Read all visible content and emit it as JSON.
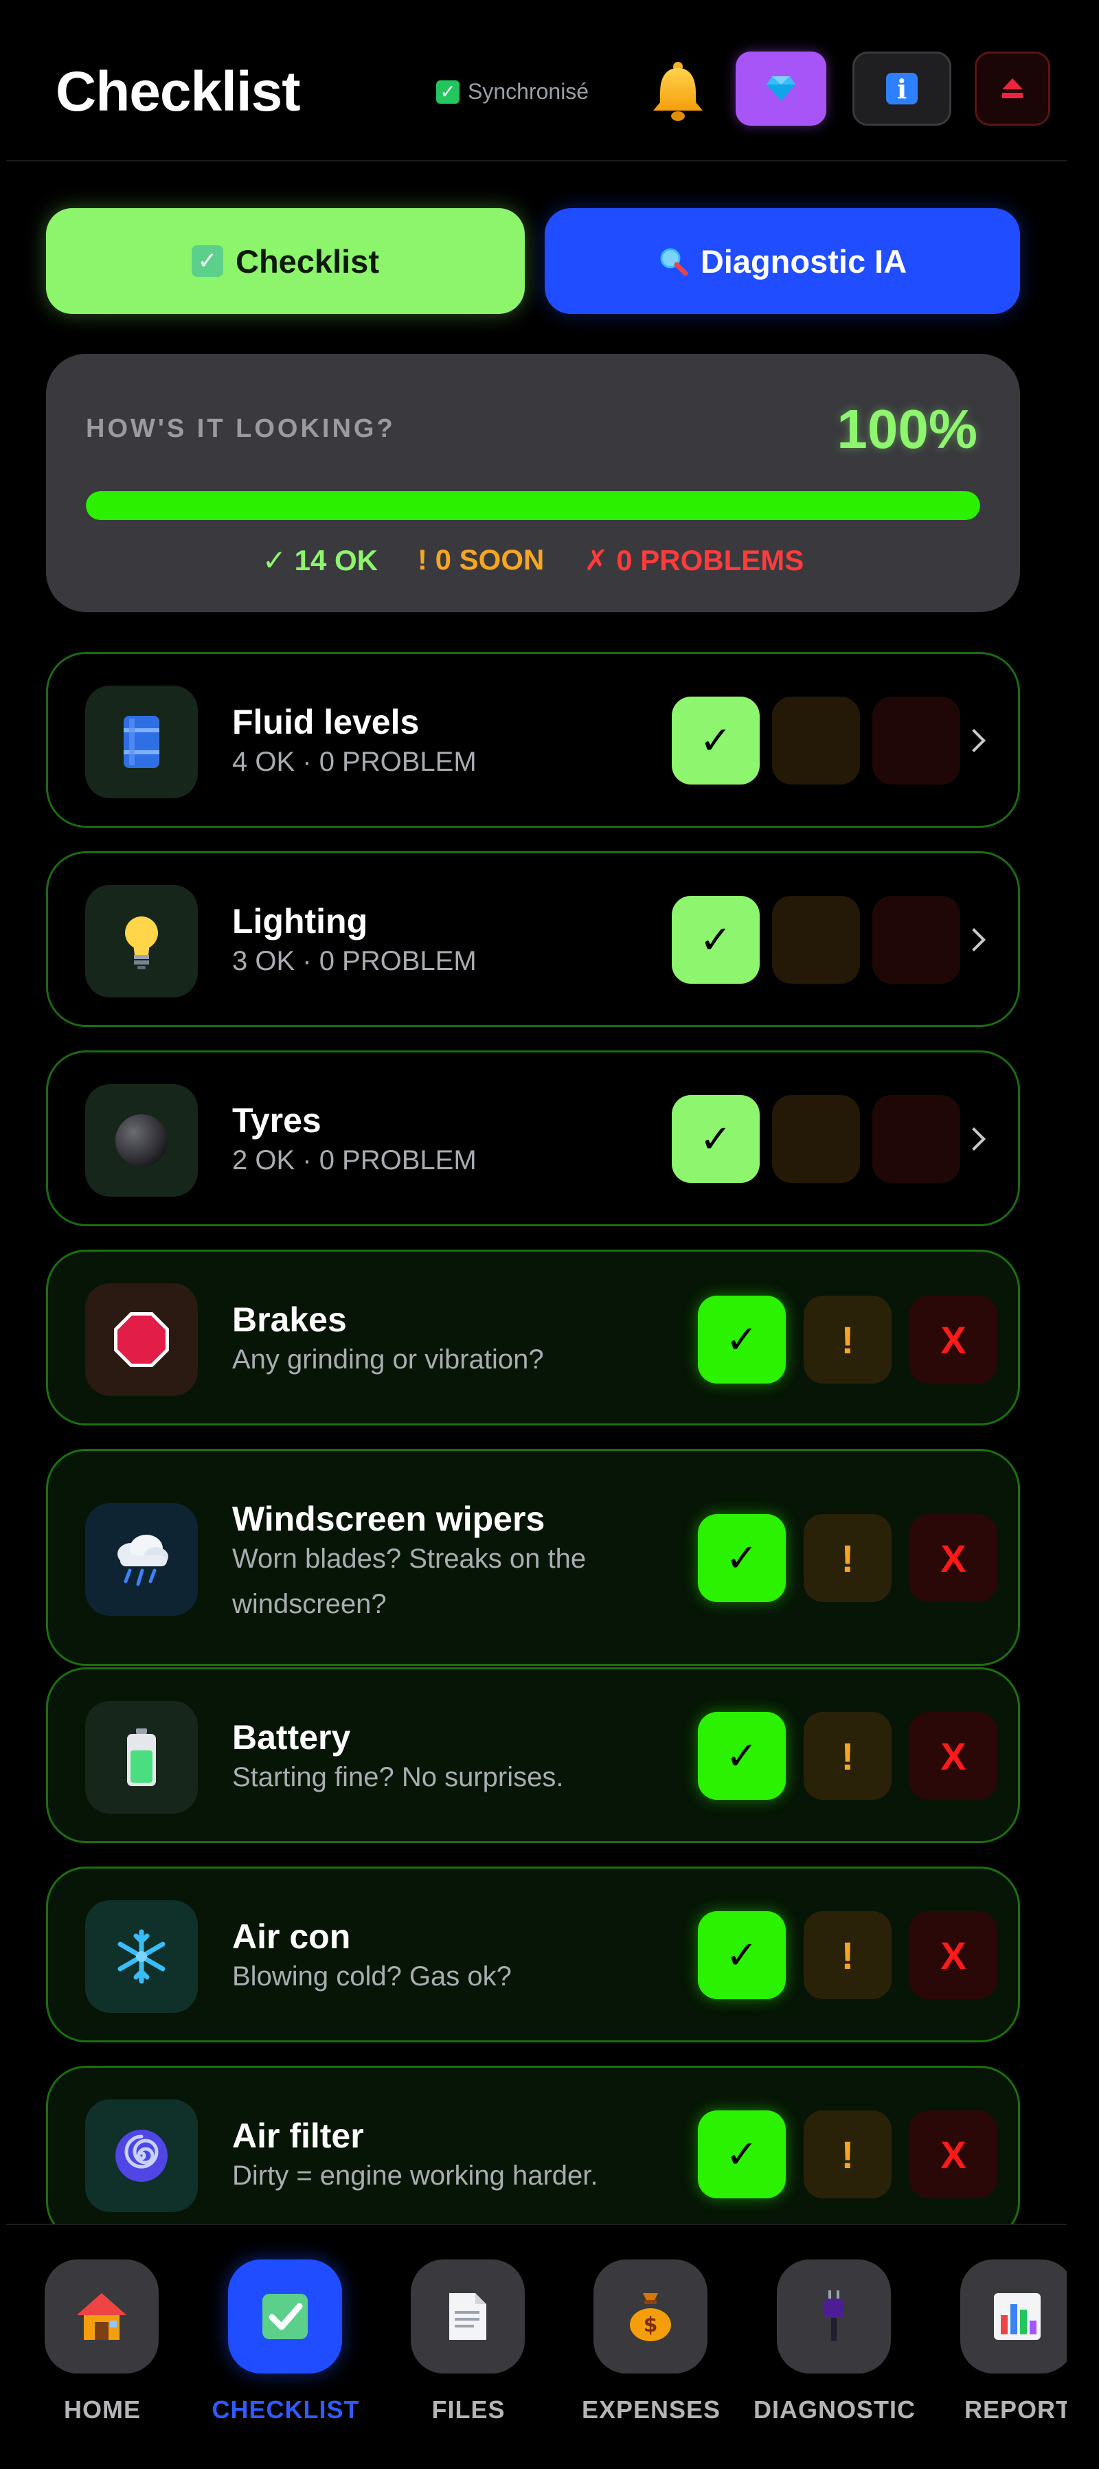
{
  "header": {
    "title": "Checklist",
    "sync_label": "Synchronisé",
    "sync_icon": "check-box-icon",
    "bell_icon": "bell-icon",
    "premium_icon": "gem-icon",
    "info_icon": "info-icon",
    "logout_icon": "eject-icon"
  },
  "tabs": [
    {
      "label": "Checklist",
      "icon": "check-box-icon",
      "active": true,
      "color": "#8cf56b"
    },
    {
      "label": "Diagnostic IA",
      "icon": "magnifier-icon",
      "active": false,
      "color": "#1f4dff"
    }
  ],
  "summary": {
    "title": "HOW'S IT LOOKING?",
    "percent_label": "100%",
    "progress": 1.0,
    "ok": "✓ 14 OK",
    "soon": "! 0 SOON",
    "problems": "✗ 0 PROBLEMS"
  },
  "items": [
    {
      "title": "Fluid levels",
      "subtitle": "4 OK · 0 PROBLEM",
      "icon": "fluid-barrel-icon",
      "state": "done",
      "expandable": true
    },
    {
      "title": "Lighting",
      "subtitle": "3 OK · 0 PROBLEM",
      "icon": "light-bulb-icon",
      "state": "done",
      "expandable": true
    },
    {
      "title": "Tyres",
      "subtitle": "2 OK · 0 PROBLEM",
      "icon": "tyre-icon",
      "state": "done",
      "expandable": true
    },
    {
      "title": "Brakes",
      "subtitle": "Any grinding or vibration?",
      "icon": "stop-sign-icon",
      "state": "ok"
    },
    {
      "title": "Windscreen wipers",
      "subtitle": "Worn blades? Streaks on the windscreen?",
      "icon": "rain-cloud-icon",
      "state": "ok"
    },
    {
      "title": "Battery",
      "subtitle": "Starting fine? No surprises.",
      "icon": "battery-icon",
      "state": "ok"
    },
    {
      "title": "Air con",
      "subtitle": "Blowing cold? Gas ok?",
      "icon": "snowflake-icon",
      "state": "ok"
    },
    {
      "title": "Air filter",
      "subtitle": "Dirty = engine working harder.",
      "icon": "spiral-icon",
      "state": "ok"
    }
  ],
  "status_buttons": {
    "ok": "✓",
    "soon": "!",
    "problem": "X"
  },
  "nav": [
    {
      "label": "HOME",
      "icon": "house-icon",
      "active": false
    },
    {
      "label": "CHECKLIST",
      "icon": "check-box-icon",
      "active": true
    },
    {
      "label": "FILES",
      "icon": "document-icon",
      "active": false
    },
    {
      "label": "EXPENSES",
      "icon": "money-bag-icon",
      "active": false
    },
    {
      "label": "DIAGNOSTIC",
      "icon": "plug-icon",
      "active": false
    },
    {
      "label": "REPORT",
      "icon": "bar-chart-icon",
      "active": false
    }
  ],
  "colors": {
    "ok": "#2af200",
    "ok_done": "#8df56e",
    "soon": "#f5a623",
    "problem": "#ff1a1a",
    "accent_blue": "#1f4dff",
    "premium": "#a855f7"
  }
}
